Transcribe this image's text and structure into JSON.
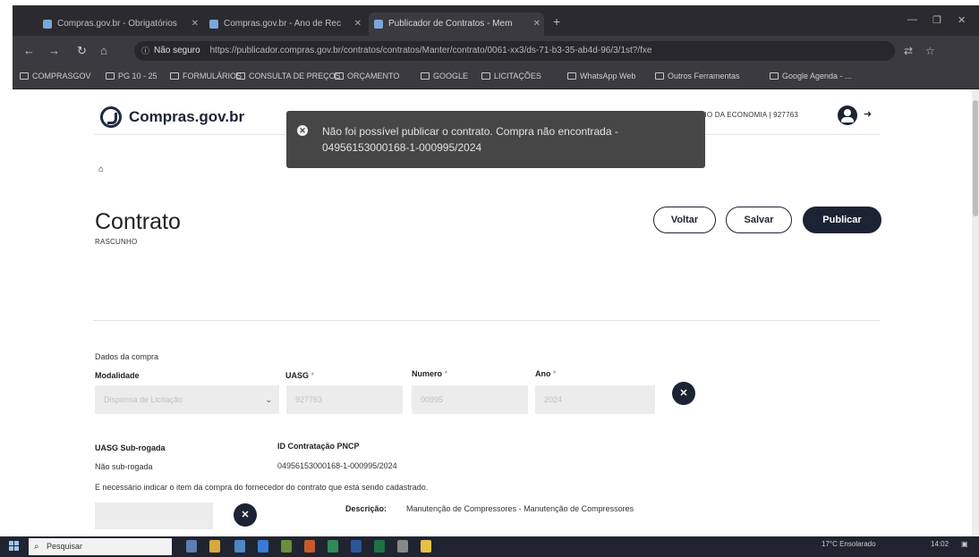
{
  "browser": {
    "tabs": [
      {
        "label": "Compras.gov.br - Obrigatórios"
      },
      {
        "label": "Compras.gov.br - Ano de Rec"
      },
      {
        "label": "Publicador de Contratos - Mem"
      }
    ],
    "new_tab": "+",
    "nav": {
      "back": "←",
      "forward": "→",
      "reload": "↻",
      "home": "⌂"
    },
    "security_label": "Não seguro",
    "url": "https://publicador.compras.gov.br/contratos/contratos/Manter/contrato/0061-xx3/ds-71-b3-35-ab4d-96/3/1st?/fxe",
    "bookmarks": [
      "COMPRASGOV",
      "PG 10 - 25",
      "FORMULÁRIOS",
      "CONSULTA DE PREÇOS",
      "ORÇAMENTO",
      "GOOGLE",
      "LICITAÇÕES",
      "WhatsApp Web",
      "Outros Ferramentas",
      "Google Agenda - ..."
    ],
    "window_controls": {
      "minimize": "—",
      "maximize": "❐",
      "close": "✕"
    }
  },
  "header": {
    "logo_text": "Compras.gov.br",
    "organization": "ERIO DA ECONOMIA | 927763"
  },
  "toast": {
    "message": "Não foi possível publicar o contrato. Compra não encontrada - 04956153000168-1-000995/2024"
  },
  "page": {
    "title": "Contrato",
    "status": "RASCUNHO",
    "buttons": {
      "back": "Voltar",
      "save": "Salvar",
      "publish": "Publicar"
    }
  },
  "purchase": {
    "section_label": "Dados da compra",
    "fields": {
      "modalidade": {
        "label": "Modalidade",
        "value": "Dispensa de Licitação"
      },
      "uasg": {
        "label": "UASG",
        "required": "*",
        "placeholder": "927763"
      },
      "numero": {
        "label": "Numero",
        "required": "*",
        "placeholder": "00995"
      },
      "ano": {
        "label": "Ano",
        "required": "*",
        "placeholder": "2024"
      }
    },
    "uasg_sub": {
      "label": "UASG Sub-rogada",
      "value": "Não sub-rogada"
    },
    "pncp_id": {
      "label": "ID Contratação PNCP",
      "value": "04956153000168-1-000995/2024"
    },
    "notice": "E necessário indicar o item da compra do fornecedor do contrato que está sendo cadastrado.",
    "description": {
      "label": "Descrição:",
      "value": "Manutenção de Compressores - Manutenção de Compressores"
    }
  },
  "taskbar": {
    "search_placeholder": "Pesquisar",
    "tray_text": "17°C Ensolarado",
    "clock": "14:02"
  }
}
